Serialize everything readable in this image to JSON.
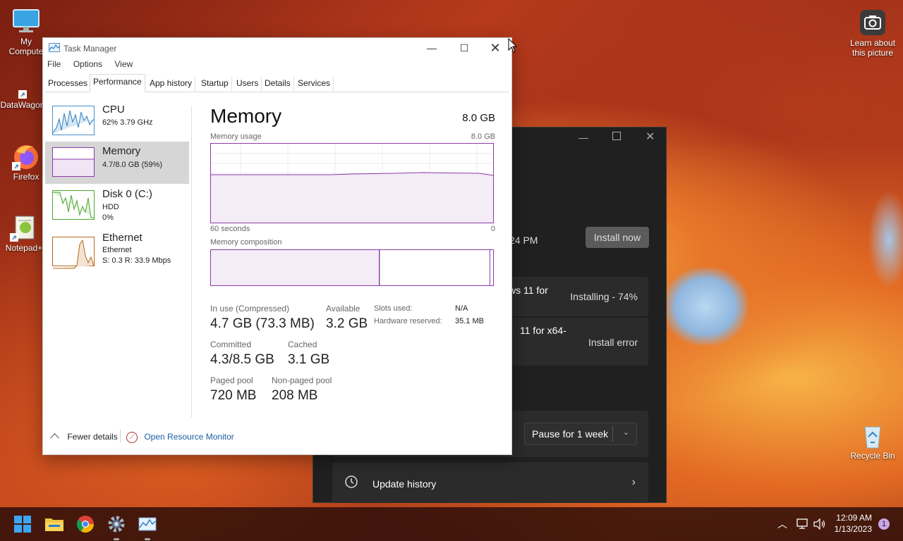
{
  "desktop": {
    "icons": [
      {
        "label": "My Compute"
      },
      {
        "label": "DataWagon"
      },
      {
        "label": "Firefox"
      },
      {
        "label": "Notepad+"
      },
      {
        "label": "Learn about this picture"
      },
      {
        "label": "Recycle Bin"
      }
    ]
  },
  "settings_bg": {
    "time_fragment": "24 PM",
    "install_now": "Install now",
    "update1_fragment": "ws 11 for",
    "update1_status": "Installing - 74%",
    "update2_fragment": "11 for x64-",
    "update2_status": "Install error",
    "pause_label": "Pause for 1 week",
    "update_history": "Update history"
  },
  "task_manager": {
    "title": "Task Manager",
    "menu": [
      "File",
      "Options",
      "View"
    ],
    "tabs": [
      "Processes",
      "Performance",
      "App history",
      "Startup",
      "Users",
      "Details",
      "Services"
    ],
    "active_tab": "Performance",
    "sidebar": [
      {
        "name": "CPU",
        "line1": "62% 3.79 GHz",
        "line2": ""
      },
      {
        "name": "Memory",
        "line1": "4.7/8.0 GB (59%)",
        "line2": ""
      },
      {
        "name": "Disk 0 (C:)",
        "line1": "HDD",
        "line2": "0%"
      },
      {
        "name": "Ethernet",
        "line1": "Ethernet",
        "line2": "S: 0.3  R: 33.9 Mbps"
      }
    ],
    "memory": {
      "title": "Memory",
      "total": "8.0 GB",
      "usage_label": "Memory usage",
      "usage_max": "8.0 GB",
      "time_left": "60 seconds",
      "time_right": "0",
      "composition_label": "Memory composition",
      "in_use_label": "In use (Compressed)",
      "in_use_value": "4.7 GB (73.3 MB)",
      "available_label": "Available",
      "available_value": "3.2 GB",
      "committed_label": "Committed",
      "committed_value": "4.3/8.5 GB",
      "cached_label": "Cached",
      "cached_value": "3.1 GB",
      "paged_label": "Paged pool",
      "paged_value": "720 MB",
      "nonpaged_label": "Non-paged pool",
      "nonpaged_value": "208 MB",
      "slots_label": "Slots used:",
      "slots_value": "N/A",
      "hw_label": "Hardware reserved:",
      "hw_value": "35.1 MB"
    },
    "footer": {
      "fewer_details": "Fewer details",
      "open_monitor": "Open Resource Monitor"
    }
  },
  "taskbar": {
    "time": "12:09 AM",
    "date": "1/13/2023",
    "notifications": "1"
  }
}
